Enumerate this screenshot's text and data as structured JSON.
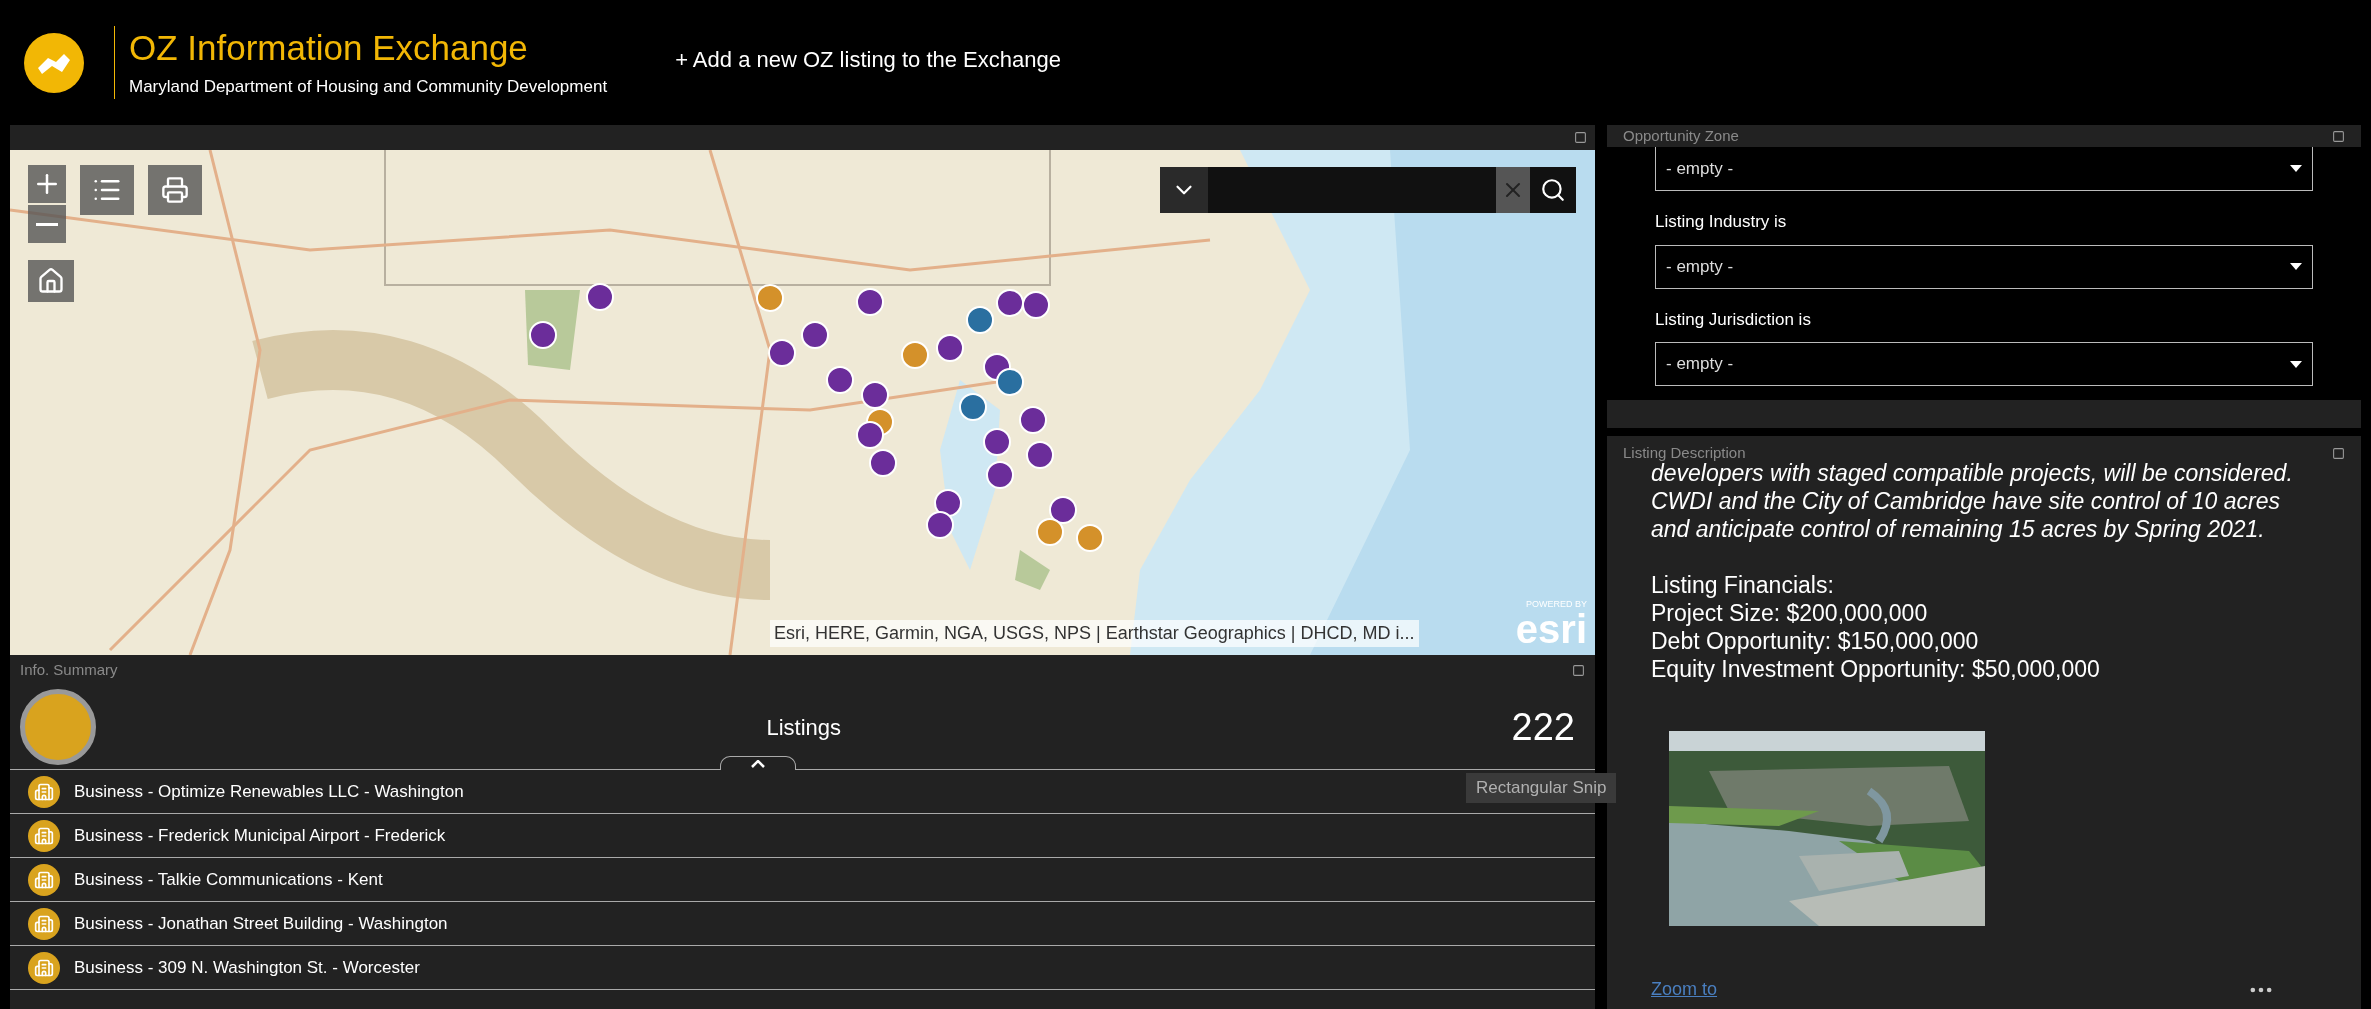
{
  "header": {
    "title": "OZ Information Exchange",
    "subtitle": "Maryland Department of Housing and Community Development",
    "add_link": "+ Add a new OZ listing to the Exchange"
  },
  "map_panel": {
    "attribution": "Esri, HERE, Garmin, NGA, USGS, NPS | Earthstar Geographics | DHCD, MD i...",
    "esri_logo": {
      "powered_by": "POWERED BY",
      "wordmark": "esri"
    }
  },
  "info_summary": {
    "title": "Info. Summary",
    "heading": "Listings",
    "count": "222",
    "listings": [
      {
        "label": "Business - Optimize Renewables LLC - Washington"
      },
      {
        "label": "Business - Frederick Municipal Airport - Frederick"
      },
      {
        "label": "Business - Talkie Communications - Kent"
      },
      {
        "label": "Business - Jonathan Street Building - Washington"
      },
      {
        "label": "Business - 309 N. Washington St. - Worcester"
      }
    ]
  },
  "filter_panel": {
    "title": "Opportunity Zone",
    "filters": [
      {
        "value": "- empty -"
      },
      {
        "label": "Listing Industry is",
        "value": "- empty -"
      },
      {
        "label": "Listing Jurisdiction is",
        "value": "- empty -"
      }
    ]
  },
  "description_panel": {
    "title": "Listing Description",
    "text": "developers with staged compatible projects, will be considered. CWDI and the City of Cambridge have site control of 10 acres and anticipate control of remaining 15 acres by Spring 2021.",
    "financials": [
      "Listing Financials:",
      "Project Size: $200,000,000",
      "Debt Opportunity: $150,000,000",
      "Equity Investment Opportunity: $50,000,000"
    ],
    "photo": {
      "kind": "picture"
    },
    "zoom_link": "Zoom to"
  },
  "snip_tooltip": "Rectangular Snip"
}
